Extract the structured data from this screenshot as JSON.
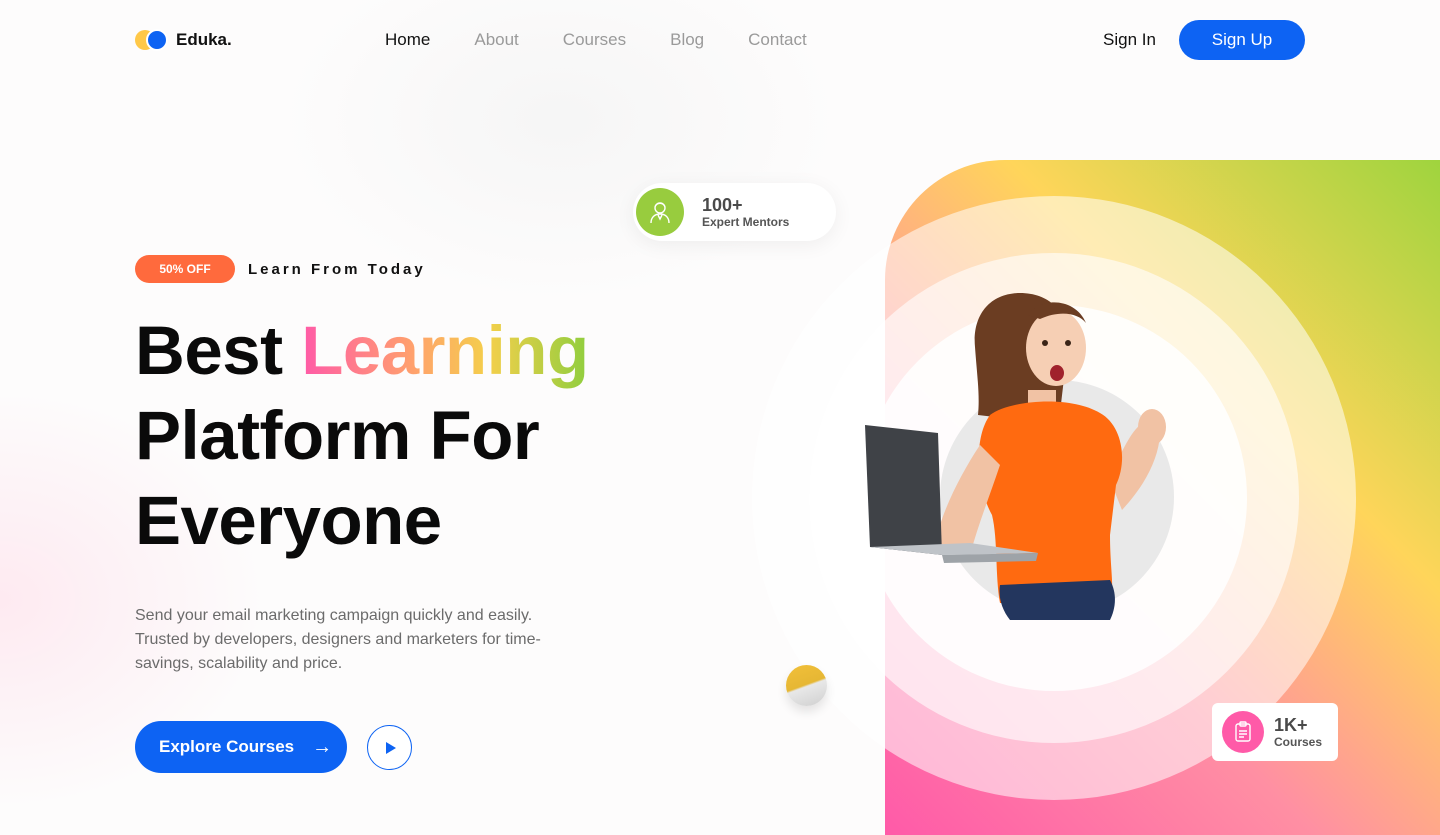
{
  "brand": {
    "name": "Eduka.",
    "colors": {
      "primary": "#0d63f3",
      "accent_yellow": "#ffc848",
      "badge": "#ff6a3d"
    }
  },
  "nav": {
    "items": [
      {
        "label": "Home",
        "active": true
      },
      {
        "label": "About",
        "active": false
      },
      {
        "label": "Courses",
        "active": false
      },
      {
        "label": "Blog",
        "active": false
      },
      {
        "label": "Contact",
        "active": false
      }
    ],
    "sign_in": "Sign In",
    "sign_up": "Sign Up"
  },
  "hero": {
    "badge": "50% OFF",
    "badge_caption": "Learn From Today",
    "headline_word1": "Best",
    "headline_highlight": "Learning",
    "headline_line2": "Platform For",
    "headline_line3": "Everyone",
    "description": "Send your email marketing campaign quickly and easily. Trusted by developers, designers and marketers for time-savings, scalability and price.",
    "cta_label": "Explore Courses",
    "cta_icon": "arrow-right-icon",
    "play_icon": "play-icon"
  },
  "stats": {
    "mentors": {
      "value": "100+",
      "label": "Expert Mentors",
      "icon": "mentor-icon"
    },
    "courses": {
      "value": "1K+",
      "label": "Courses",
      "icon": "document-icon"
    }
  }
}
